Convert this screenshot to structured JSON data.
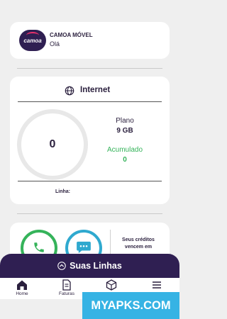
{
  "profile": {
    "logo_text": "camoa",
    "brand": "CAMOA MÓVEL",
    "greeting": "Olá"
  },
  "internet": {
    "title": "Internet",
    "usage_value": "0",
    "plan_label": "Plano",
    "plan_value": "9 GB",
    "accumulated_label": "Acumulado",
    "accumulated_value": "0",
    "line_label": "Linha:"
  },
  "actions": {
    "credits_line1": "Seus créditos",
    "credits_line2": "vencem em"
  },
  "lines_bar": {
    "label": "Suas Linhas"
  },
  "nav": {
    "home": "Home",
    "invoices": "Faturas"
  },
  "watermark": {
    "text": "MYAPKS.COM"
  },
  "colors": {
    "brand": "#2f1f52",
    "accent_green": "#35b35a",
    "accent_blue": "#2fa9cf",
    "logo_pink": "#e8306a"
  }
}
